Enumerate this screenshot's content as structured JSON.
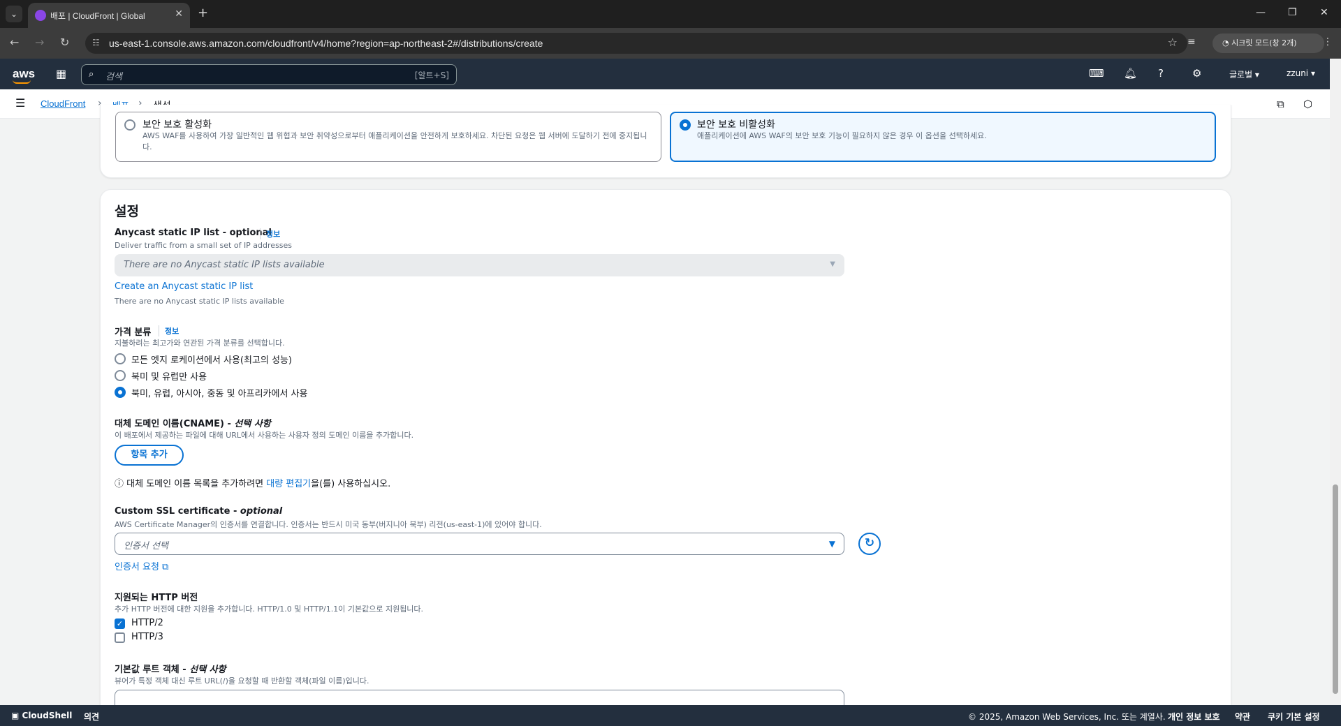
{
  "browser": {
    "tab_title": "배포 | CloudFront | Global",
    "url": "us-east-1.console.aws.amazon.com/cloudfront/v4/home?region=ap-northeast-2#/distributions/create",
    "incognito_label": "시크릿 모드(창 2개)"
  },
  "aws_header": {
    "logo": "aws",
    "search_placeholder": "검색",
    "search_shortcut": "[알트+S]",
    "region": "글로벌 ▾",
    "user": "zzuni ▾"
  },
  "breadcrumb": {
    "items": [
      "CloudFront",
      "배포",
      "생성"
    ]
  },
  "security": {
    "enable": {
      "title": "보안 보호 활성화",
      "desc": "AWS WAF를 사용하여 가장 일반적인 웹 위협과 보안 취약성으로부터 애플리케이션을 안전하게 보호하세요. 차단된 요청은 웹 서버에 도달하기 전에 중지됩니다."
    },
    "disable": {
      "title": "보안 보호 비활성화",
      "desc": "애플리케이션에 AWS WAF의 보안 보호 기능이 필요하지 않은 경우 이 옵션을 선택하세요."
    },
    "selected": "disable"
  },
  "settings": {
    "heading": "설정",
    "info": "정보",
    "anycast": {
      "label": "Anycast static IP list - optional",
      "desc": "Deliver traffic from a small set of IP addresses",
      "select_placeholder": "There are no Anycast static IP lists available",
      "create_link": "Create an Anycast static IP list",
      "note": "There are no Anycast static IP lists available"
    },
    "price_class": {
      "label": "가격 분류",
      "desc": "지불하려는 최고가와 연관된 가격 분류를 선택합니다.",
      "options": [
        "모든 엣지 로케이션에서 사용(최고의 성능)",
        "북미 및 유럽만 사용",
        "북미, 유럽, 아시아, 중동 및 아프리카에서 사용"
      ],
      "selected_index": 2
    },
    "cname": {
      "label_main": "대체 도메인 이름(CNAME) - ",
      "label_opt": "선택 사항",
      "desc": "이 배포에서 제공하는 파일에 대해 URL에서 사용하는 사용자 정의 도메인 이름을 추가합니다.",
      "add_button": "항목 추가",
      "notice_pre": "대체 도메인 이름 목록을 추가하려면 ",
      "notice_link": "대량 편집기",
      "notice_post": "을(를) 사용하십시오."
    },
    "ssl": {
      "label_main": "Custom SSL certificate - ",
      "label_opt": "optional",
      "desc": "AWS Certificate Manager의 인증서를 연결합니다. 인증서는 반드시 미국 동부(버지니아 북부) 리전(us-east-1)에 있어야 합니다.",
      "select_placeholder": "인증서 선택",
      "request_link": "인증서 요청"
    },
    "http": {
      "label": "지원되는 HTTP 버전",
      "desc": "추가 HTTP 버전에 대한 지원을 추가합니다. HTTP/1.0 및 HTTP/1.1이 기본값으로 지원됩니다.",
      "options": [
        {
          "label": "HTTP/2",
          "checked": true
        },
        {
          "label": "HTTP/3",
          "checked": false
        }
      ]
    },
    "root_object": {
      "label_main": "기본값 루트 객체 - ",
      "label_opt": "선택 사항",
      "desc": "뷰어가 특정 객체 대신 루트 URL(/)을 요청할 때 반환할 객체(파일 이름)입니다."
    }
  },
  "footer": {
    "cloudshell": "CloudShell",
    "feedback": "의견",
    "copyright": "© 2025, Amazon Web Services, Inc. 또는 계열사.",
    "privacy": "개인 정보 보호",
    "terms": "약관",
    "cookies": "쿠키 기본 설정"
  }
}
